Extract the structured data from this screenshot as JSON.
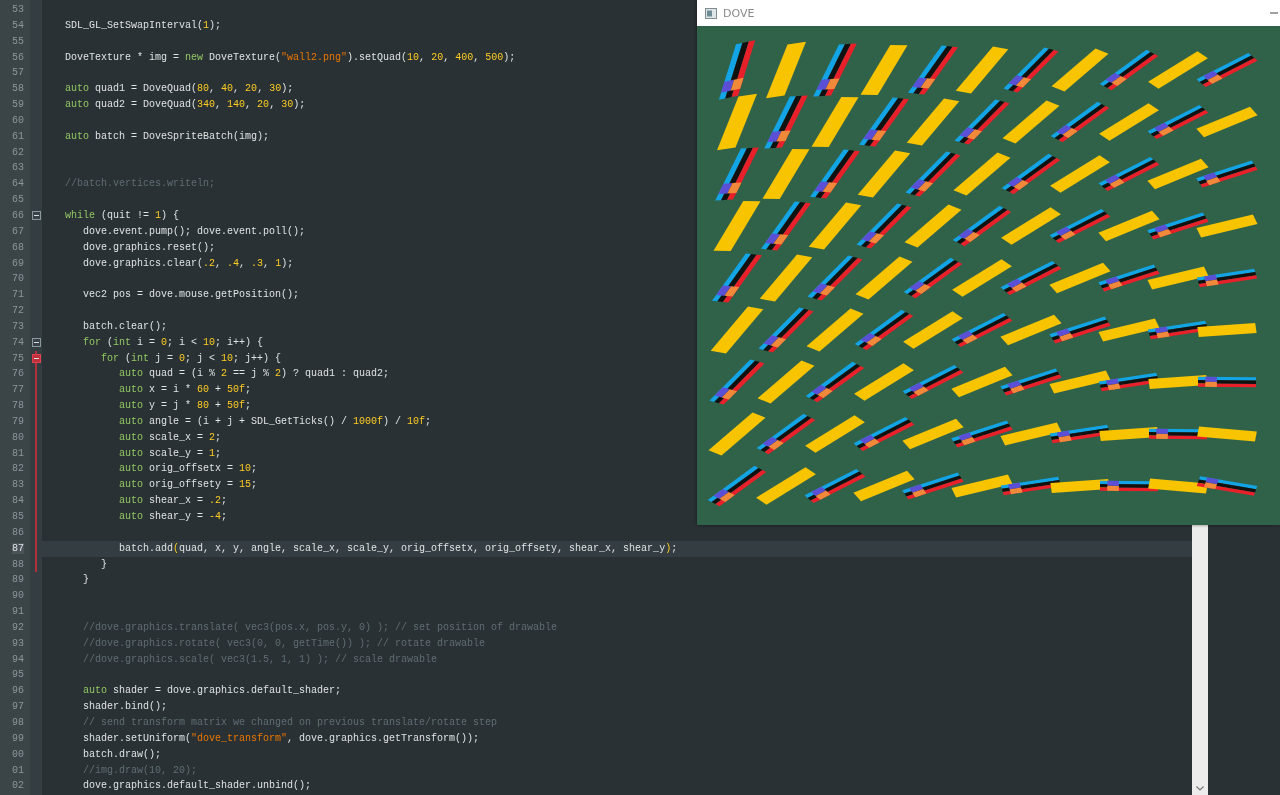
{
  "editor": {
    "lines": [
      {
        "number": "53",
        "current": false,
        "fold": false,
        "changed": false
      },
      {
        "number": "54",
        "current": false,
        "fold": false,
        "changed": false,
        "tokens": [
          {
            "kind": "plain",
            "text": "SDL_GL_SetSwapInterval("
          },
          {
            "kind": "number",
            "text": "1"
          },
          {
            "kind": "plain",
            "text": ");"
          }
        ]
      },
      {
        "number": "55",
        "current": false,
        "fold": false,
        "changed": false
      },
      {
        "number": "56",
        "current": false,
        "fold": false,
        "changed": false,
        "tokens": [
          {
            "kind": "plain",
            "text": "DoveTexture * img = "
          },
          {
            "kind": "keyword",
            "text": "new"
          },
          {
            "kind": "plain",
            "text": " DoveTexture("
          },
          {
            "kind": "string",
            "text": "\"wall2.png\""
          },
          {
            "kind": "plain",
            "text": ").setQuad("
          },
          {
            "kind": "number",
            "text": "10"
          },
          {
            "kind": "plain",
            "text": ", "
          },
          {
            "kind": "number",
            "text": "20"
          },
          {
            "kind": "plain",
            "text": ", "
          },
          {
            "kind": "number",
            "text": "400"
          },
          {
            "kind": "plain",
            "text": ", "
          },
          {
            "kind": "number",
            "text": "500"
          },
          {
            "kind": "plain",
            "text": ");"
          }
        ]
      },
      {
        "number": "57",
        "current": false,
        "fold": false,
        "changed": false
      },
      {
        "number": "58",
        "current": false,
        "fold": false,
        "changed": false,
        "tokens": [
          {
            "kind": "keyword",
            "text": "auto"
          },
          {
            "kind": "plain",
            "text": " quad1 = DoveQuad("
          },
          {
            "kind": "number",
            "text": "80"
          },
          {
            "kind": "plain",
            "text": ", "
          },
          {
            "kind": "number",
            "text": "40"
          },
          {
            "kind": "plain",
            "text": ", "
          },
          {
            "kind": "number",
            "text": "20"
          },
          {
            "kind": "plain",
            "text": ", "
          },
          {
            "kind": "number",
            "text": "30"
          },
          {
            "kind": "plain",
            "text": ");"
          }
        ]
      },
      {
        "number": "59",
        "current": false,
        "fold": false,
        "changed": false,
        "tokens": [
          {
            "kind": "keyword",
            "text": "auto"
          },
          {
            "kind": "plain",
            "text": " quad2 = DoveQuad("
          },
          {
            "kind": "number",
            "text": "340"
          },
          {
            "kind": "plain",
            "text": ", "
          },
          {
            "kind": "number",
            "text": "140"
          },
          {
            "kind": "plain",
            "text": ", "
          },
          {
            "kind": "number",
            "text": "20"
          },
          {
            "kind": "plain",
            "text": ", "
          },
          {
            "kind": "number",
            "text": "30"
          },
          {
            "kind": "plain",
            "text": ");"
          }
        ]
      },
      {
        "number": "60",
        "current": false,
        "fold": false,
        "changed": false
      },
      {
        "number": "61",
        "current": false,
        "fold": false,
        "changed": false,
        "tokens": [
          {
            "kind": "keyword",
            "text": "auto"
          },
          {
            "kind": "plain",
            "text": " batch = DoveSpriteBatch(img);"
          }
        ]
      },
      {
        "number": "62",
        "current": false,
        "fold": false,
        "changed": false
      },
      {
        "number": "63",
        "current": false,
        "fold": false,
        "changed": false
      },
      {
        "number": "64",
        "current": false,
        "fold": false,
        "changed": false,
        "tokens": [
          {
            "kind": "comment",
            "text": "//batch.vertices.writeln;"
          }
        ]
      },
      {
        "number": "65",
        "current": false,
        "fold": false,
        "changed": false
      },
      {
        "number": "66",
        "current": false,
        "fold": true,
        "changed": false,
        "tokens": [
          {
            "kind": "keyword",
            "text": "while"
          },
          {
            "kind": "plain",
            "text": " (quit != "
          },
          {
            "kind": "number",
            "text": "1"
          },
          {
            "kind": "plain",
            "text": ") {"
          }
        ]
      },
      {
        "number": "67",
        "current": false,
        "fold": false,
        "changed": false,
        "tokens": [
          {
            "kind": "plain",
            "text": "   dove.event.pump(); dove.event.poll();"
          }
        ]
      },
      {
        "number": "68",
        "current": false,
        "fold": false,
        "changed": false,
        "tokens": [
          {
            "kind": "plain",
            "text": "   dove.graphics.reset();"
          }
        ]
      },
      {
        "number": "69",
        "current": false,
        "fold": false,
        "changed": false,
        "tokens": [
          {
            "kind": "plain",
            "text": "   dove.graphics.clear("
          },
          {
            "kind": "number",
            "text": ".2"
          },
          {
            "kind": "plain",
            "text": ", "
          },
          {
            "kind": "number",
            "text": ".4"
          },
          {
            "kind": "plain",
            "text": ", "
          },
          {
            "kind": "number",
            "text": ".3"
          },
          {
            "kind": "plain",
            "text": ", "
          },
          {
            "kind": "number",
            "text": "1"
          },
          {
            "kind": "plain",
            "text": ");"
          }
        ]
      },
      {
        "number": "70",
        "current": false,
        "fold": false,
        "changed": false
      },
      {
        "number": "71",
        "current": false,
        "fold": false,
        "changed": false,
        "tokens": [
          {
            "kind": "plain",
            "text": "   vec2 pos = dove.mouse.getPosition();"
          }
        ]
      },
      {
        "number": "72",
        "current": false,
        "fold": false,
        "changed": false
      },
      {
        "number": "73",
        "current": false,
        "fold": false,
        "changed": false,
        "tokens": [
          {
            "kind": "plain",
            "text": "   batch.clear();"
          }
        ]
      },
      {
        "number": "74",
        "current": false,
        "fold": true,
        "changed": false,
        "tokens": [
          {
            "kind": "keyword",
            "text": "   for"
          },
          {
            "kind": "plain",
            "text": " ("
          },
          {
            "kind": "keyword",
            "text": "int"
          },
          {
            "kind": "plain",
            "text": " i = "
          },
          {
            "kind": "number",
            "text": "0"
          },
          {
            "kind": "plain",
            "text": "; i < "
          },
          {
            "kind": "number",
            "text": "10"
          },
          {
            "kind": "plain",
            "text": "; i++) {"
          }
        ]
      },
      {
        "number": "75",
        "current": false,
        "fold": true,
        "changed": true,
        "tokens": [
          {
            "kind": "keyword",
            "text": "      for"
          },
          {
            "kind": "plain",
            "text": " ("
          },
          {
            "kind": "keyword",
            "text": "int"
          },
          {
            "kind": "plain",
            "text": " j = "
          },
          {
            "kind": "number",
            "text": "0"
          },
          {
            "kind": "plain",
            "text": "; j < "
          },
          {
            "kind": "number",
            "text": "10"
          },
          {
            "kind": "plain",
            "text": "; j++) {"
          }
        ]
      },
      {
        "number": "76",
        "current": false,
        "fold": false,
        "changed": true,
        "tokens": [
          {
            "kind": "keyword",
            "text": "         auto"
          },
          {
            "kind": "plain",
            "text": " quad = (i % "
          },
          {
            "kind": "number",
            "text": "2"
          },
          {
            "kind": "plain",
            "text": " == j % "
          },
          {
            "kind": "number",
            "text": "2"
          },
          {
            "kind": "plain",
            "text": ") ? quad1 : quad2;"
          }
        ]
      },
      {
        "number": "77",
        "current": false,
        "fold": false,
        "changed": true,
        "tokens": [
          {
            "kind": "keyword",
            "text": "         auto"
          },
          {
            "kind": "plain",
            "text": " x = i * "
          },
          {
            "kind": "number",
            "text": "60"
          },
          {
            "kind": "plain",
            "text": " + "
          },
          {
            "kind": "number",
            "text": "50f"
          },
          {
            "kind": "plain",
            "text": ";"
          }
        ]
      },
      {
        "number": "78",
        "current": false,
        "fold": false,
        "changed": true,
        "tokens": [
          {
            "kind": "keyword",
            "text": "         auto"
          },
          {
            "kind": "plain",
            "text": " y = j * "
          },
          {
            "kind": "number",
            "text": "80"
          },
          {
            "kind": "plain",
            "text": " + "
          },
          {
            "kind": "number",
            "text": "50f"
          },
          {
            "kind": "plain",
            "text": ";"
          }
        ]
      },
      {
        "number": "79",
        "current": false,
        "fold": false,
        "changed": true,
        "tokens": [
          {
            "kind": "keyword",
            "text": "         auto"
          },
          {
            "kind": "plain",
            "text": " angle = (i + j + SDL_GetTicks() / "
          },
          {
            "kind": "number",
            "text": "1000f"
          },
          {
            "kind": "plain",
            "text": ") / "
          },
          {
            "kind": "number",
            "text": "10f"
          },
          {
            "kind": "plain",
            "text": ";"
          }
        ]
      },
      {
        "number": "80",
        "current": false,
        "fold": false,
        "changed": true,
        "tokens": [
          {
            "kind": "keyword",
            "text": "         auto"
          },
          {
            "kind": "plain",
            "text": " scale_x = "
          },
          {
            "kind": "number",
            "text": "2"
          },
          {
            "kind": "plain",
            "text": ";"
          }
        ]
      },
      {
        "number": "81",
        "current": false,
        "fold": false,
        "changed": true,
        "tokens": [
          {
            "kind": "keyword",
            "text": "         auto"
          },
          {
            "kind": "plain",
            "text": " scale_y = "
          },
          {
            "kind": "number",
            "text": "1"
          },
          {
            "kind": "plain",
            "text": ";"
          }
        ]
      },
      {
        "number": "82",
        "current": false,
        "fold": false,
        "changed": true,
        "tokens": [
          {
            "kind": "keyword",
            "text": "         auto"
          },
          {
            "kind": "plain",
            "text": " orig_offsetx = "
          },
          {
            "kind": "number",
            "text": "10"
          },
          {
            "kind": "plain",
            "text": ";"
          }
        ]
      },
      {
        "number": "83",
        "current": false,
        "fold": false,
        "changed": true,
        "tokens": [
          {
            "kind": "keyword",
            "text": "         auto"
          },
          {
            "kind": "plain",
            "text": " orig_offsety = "
          },
          {
            "kind": "number",
            "text": "15"
          },
          {
            "kind": "plain",
            "text": ";"
          }
        ]
      },
      {
        "number": "84",
        "current": false,
        "fold": false,
        "changed": true,
        "tokens": [
          {
            "kind": "keyword",
            "text": "         auto"
          },
          {
            "kind": "plain",
            "text": " shear_x = "
          },
          {
            "kind": "number",
            "text": ".2"
          },
          {
            "kind": "plain",
            "text": ";"
          }
        ]
      },
      {
        "number": "85",
        "current": false,
        "fold": false,
        "changed": true,
        "tokens": [
          {
            "kind": "keyword",
            "text": "         auto"
          },
          {
            "kind": "plain",
            "text": " shear_y = "
          },
          {
            "kind": "number",
            "text": "-4"
          },
          {
            "kind": "plain",
            "text": ";"
          }
        ]
      },
      {
        "number": "86",
        "current": false,
        "fold": false,
        "changed": true
      },
      {
        "number": "87",
        "current": true,
        "fold": false,
        "changed": true,
        "tokens": [
          {
            "kind": "plain",
            "text": "         batch.add"
          },
          {
            "kind": "match",
            "text": "("
          },
          {
            "kind": "plain",
            "text": "quad, x, y, angle, scale_x, scale_y, orig_offsetx, orig_offsety, shear_x, shear_y"
          },
          {
            "kind": "match",
            "text": ")"
          },
          {
            "kind": "plain",
            "text": ";"
          }
        ]
      },
      {
        "number": "88",
        "current": false,
        "fold": false,
        "changed": true,
        "tokens": [
          {
            "kind": "plain",
            "text": "      }"
          }
        ]
      },
      {
        "number": "89",
        "current": false,
        "fold": false,
        "changed": false,
        "tokens": [
          {
            "kind": "plain",
            "text": "   }"
          }
        ]
      },
      {
        "number": "90",
        "current": false,
        "fold": false,
        "changed": false
      },
      {
        "number": "91",
        "current": false,
        "fold": false,
        "changed": false
      },
      {
        "number": "92",
        "current": false,
        "fold": false,
        "changed": false,
        "tokens": [
          {
            "kind": "comment",
            "text": "   //dove.graphics.translate( vec3(pos.x, pos.y, 0) ); // set position of drawable"
          }
        ]
      },
      {
        "number": "93",
        "current": false,
        "fold": false,
        "changed": false,
        "tokens": [
          {
            "kind": "comment",
            "text": "   //dove.graphics.rotate( vec3(0, 0, getTime()) ); // rotate drawable"
          }
        ]
      },
      {
        "number": "94",
        "current": false,
        "fold": false,
        "changed": false,
        "tokens": [
          {
            "kind": "comment",
            "text": "   //dove.graphics.scale( vec3(1.5, 1, 1) ); // scale drawable"
          }
        ]
      },
      {
        "number": "95",
        "current": false,
        "fold": false,
        "changed": false
      },
      {
        "number": "96",
        "current": false,
        "fold": false,
        "changed": false,
        "tokens": [
          {
            "kind": "keyword",
            "text": "   auto"
          },
          {
            "kind": "plain",
            "text": " shader = dove.graphics.default_shader;"
          }
        ]
      },
      {
        "number": "97",
        "current": false,
        "fold": false,
        "changed": false,
        "tokens": [
          {
            "kind": "plain",
            "text": "   shader.bind();"
          }
        ]
      },
      {
        "number": "98",
        "current": false,
        "fold": false,
        "changed": false,
        "tokens": [
          {
            "kind": "comment",
            "text": "   // send transform matrix we changed on previous translate/rotate step"
          }
        ]
      },
      {
        "number": "99",
        "current": false,
        "fold": false,
        "changed": false,
        "tokens": [
          {
            "kind": "plain",
            "text": "   shader.setUniform("
          },
          {
            "kind": "string",
            "text": "\"dove_transform\""
          },
          {
            "kind": "plain",
            "text": ", dove.graphics.getTransform());"
          }
        ]
      },
      {
        "number": "00",
        "current": false,
        "fold": false,
        "changed": false,
        "tokens": [
          {
            "kind": "plain",
            "text": "   batch.draw();"
          }
        ]
      },
      {
        "number": "01",
        "current": false,
        "fold": false,
        "changed": false,
        "tokens": [
          {
            "kind": "comment",
            "text": "   //img.draw(10, 20);"
          }
        ]
      },
      {
        "number": "02",
        "current": false,
        "fold": false,
        "changed": false,
        "tokens": [
          {
            "kind": "plain",
            "text": "   dove.graphics.default_shader.unbind();"
          }
        ]
      }
    ]
  },
  "window": {
    "title": "DOVE"
  }
}
